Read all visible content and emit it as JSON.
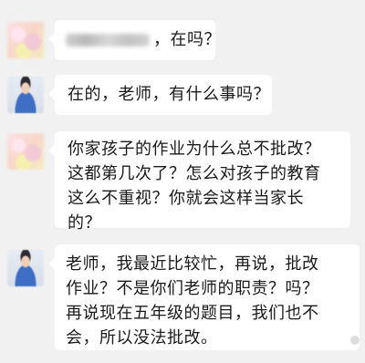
{
  "conversation": {
    "messages": [
      {
        "sender": "parent",
        "avatar_icon": "parent-avatar",
        "blurred_name_prefix": true,
        "lines": [
          "，在吗？"
        ]
      },
      {
        "sender": "teacher",
        "avatar_icon": "teacher-avatar",
        "lines": [
          "在的，老师，有什么事吗？"
        ]
      },
      {
        "sender": "parent",
        "avatar_icon": "parent-avatar",
        "lines": [
          "你家孩子的作业为什么总不批改？",
          "这都第几次了？怎么对孩子的教育",
          "这么不重视？你就会这样当家长",
          "的？"
        ]
      },
      {
        "sender": "teacher",
        "avatar_icon": "teacher-avatar",
        "lines": [
          "老师，我最近比较忙，再说，批改",
          "作业？不是你们老师的职责？吗？",
          "再说现在五年级的题目，我们也不",
          "会，所以没法批改。"
        ]
      }
    ]
  },
  "colors": {
    "background": "#f1f1f1",
    "bubble": "#ffffff",
    "text": "#1a1a1a"
  }
}
